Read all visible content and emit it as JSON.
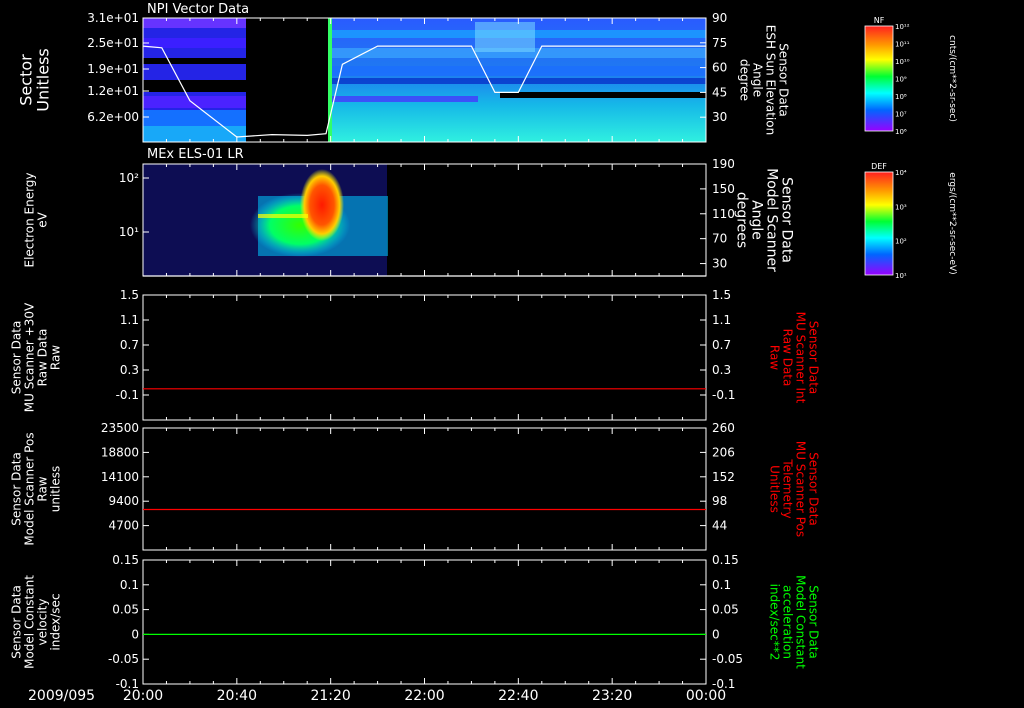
{
  "date_label": "2009/095",
  "time_ticks": [
    "20:00",
    "20:40",
    "21:20",
    "22:00",
    "22:40",
    "23:20",
    "00:00"
  ],
  "colors": {
    "background": "#000000",
    "axis": "#ffffff",
    "line_white": "#ffffff",
    "line_red": "#ff0000",
    "line_green": "#00ff00"
  },
  "colorbars": [
    {
      "title": "NF",
      "unit": "cnts/(cm**2-sr-sec)",
      "ticks": [
        "10¹²",
        "10¹¹",
        "10¹⁰",
        "10⁹",
        "10⁸",
        "10⁷",
        "10⁶"
      ]
    },
    {
      "title": "DEF",
      "unit": "ergs/(cm**2-sr-sec-eV)",
      "ticks": [
        "10⁴",
        "10³",
        "10²",
        "10¹"
      ]
    }
  ],
  "chart_data": [
    {
      "type": "heatmap",
      "title": "NPI Vector Data",
      "ylabel_left": [
        "Sector",
        "Unitless"
      ],
      "yticks_left": [
        "3.1e+01",
        "2.5e+01",
        "1.9e+01",
        "1.2e+01",
        "6.2e+00"
      ],
      "ylabel_right": [
        "Sensor Data",
        "ESH Sun Elevation",
        "Angle",
        "degree"
      ],
      "yticks_right": [
        90,
        75,
        60,
        45,
        30
      ],
      "yrange_right": [
        15,
        90
      ],
      "line": {
        "name": "ESH Sun Elevation Angle",
        "x": [
          "20:00",
          "20:08",
          "20:20",
          "20:40",
          "20:55",
          "21:10",
          "21:18",
          "21:25",
          "21:40",
          "22:20",
          "22:30",
          "22:40",
          "22:50",
          "23:00",
          "00:00"
        ],
        "y": [
          73,
          72,
          40,
          18,
          19.5,
          19,
          20,
          62,
          73,
          73,
          45,
          45,
          73,
          73,
          73
        ]
      }
    },
    {
      "type": "heatmap",
      "title": "MEx ELS-01 LR",
      "ylabel_left": [
        "Electron Energy",
        "eV"
      ],
      "yticks_left": [
        "10²",
        "10¹"
      ],
      "ylabel_right": [
        "Sensor Data",
        "Model Scanner",
        "Angle",
        "degrees"
      ],
      "yticks_right": [
        190,
        150,
        110,
        70,
        30
      ],
      "yrange_right": [
        10,
        190
      ],
      "line": {
        "name": "Model Scanner Angle",
        "x": [
          "20:00",
          "00:00"
        ],
        "y": [
          10,
          10
        ]
      }
    },
    {
      "type": "line",
      "ylabel_left": [
        "Sensor Data",
        "MU Scanner +30V",
        "Raw Data",
        "Raw"
      ],
      "yticks_left": [
        1.5,
        1.1,
        0.7,
        0.3,
        -0.1
      ],
      "ylim_left": [
        -0.5,
        1.5
      ],
      "ylabel_right": [
        "Sensor Data",
        "MU Scanner Int",
        "Raw Data",
        "Raw"
      ],
      "yticks_right": [
        1.5,
        1.1,
        0.7,
        0.3,
        -0.1
      ],
      "series": [
        {
          "x": [
            "20:00",
            "00:00"
          ],
          "y": [
            0.0,
            0.0
          ],
          "color": "#ff0000"
        }
      ]
    },
    {
      "type": "line",
      "ylabel_left": [
        "Sensor Data",
        "Model Scanner Pos",
        "Raw",
        "unitless"
      ],
      "yticks_left": [
        23500,
        18800,
        14100,
        9400,
        4700
      ],
      "ylim_left": [
        0,
        23500
      ],
      "ylabel_right": [
        "Sensor Data",
        "MU Scanner Pos",
        "Telemetry",
        "Unitless"
      ],
      "yticks_right": [
        260,
        206,
        152,
        98,
        44
      ],
      "series": [
        {
          "x": [
            "20:00",
            "00:00"
          ],
          "y": [
            7800,
            7800
          ],
          "color": "#ff0000"
        }
      ]
    },
    {
      "type": "line",
      "ylabel_left": [
        "Sensor Data",
        "Model Constant",
        "velocity",
        "index/sec"
      ],
      "yticks_left": [
        0.15,
        0.1,
        0.05,
        0.0,
        -0.05,
        -0.1
      ],
      "ylim_left": [
        -0.1,
        0.15
      ],
      "ylabel_right": [
        "Sensor Data",
        "Model Constant",
        "acceleration",
        "index/sec**2"
      ],
      "yticks_right": [
        0.15,
        0.1,
        0.05,
        0.0,
        -0.05,
        -0.1
      ],
      "series": [
        {
          "x": [
            "20:00",
            "00:00"
          ],
          "y": [
            0.0,
            0.0
          ],
          "color": "#00ff00"
        }
      ]
    }
  ]
}
